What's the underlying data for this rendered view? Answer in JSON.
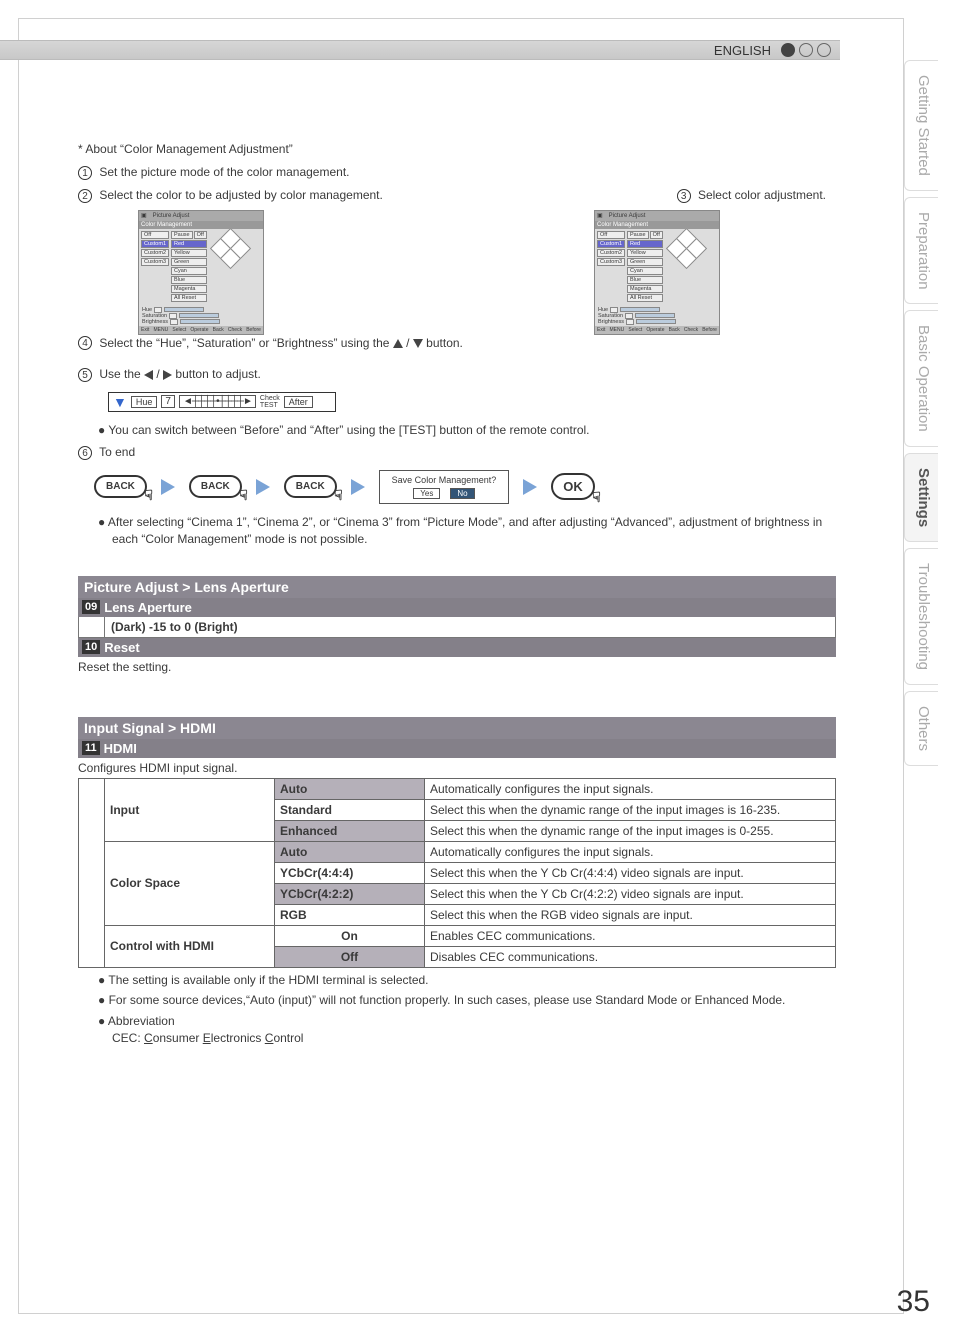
{
  "header": {
    "language": "ENGLISH"
  },
  "sidebar": {
    "tabs": [
      {
        "label": "Getting Started"
      },
      {
        "label": "Preparation"
      },
      {
        "label": "Basic Operation"
      },
      {
        "label": "Settings"
      },
      {
        "label": "Troubleshooting"
      },
      {
        "label": "Others"
      }
    ],
    "active_index": 3
  },
  "intro": {
    "about": "* About “Color Management Adjustment”",
    "step1": "Set the picture mode of the color management.",
    "step2": "Select the color to be adjusted by color management.",
    "step3": "Select color adjustment.",
    "step4_a": "Select the “Hue”, “Saturation” or “Brightness” using the ",
    "step4_b": " / ",
    "step4_c": " button.",
    "step5_a": "Use the ",
    "step5_b": " / ",
    "step5_c": " button to adjust.",
    "step6": "To end"
  },
  "onscreen": {
    "title": "Color Management",
    "modes": [
      "Off",
      "Custom1",
      "Custom2",
      "Custom3"
    ],
    "pause": "Pause",
    "off": "Off",
    "colors": [
      "Red",
      "Yellow",
      "Green",
      "Cyan",
      "Blue",
      "Magenta",
      "All Reset"
    ],
    "params": [
      "Hue",
      "Saturation",
      "Brightness"
    ],
    "footer": [
      "Exit",
      "MENU",
      "Select",
      "Operate",
      "Back",
      "Check",
      "Before"
    ],
    "footer2": [
      "Exit",
      "MENU",
      "Select",
      "Operate",
      "Back",
      "Check",
      "Before"
    ],
    "picture_adjust": "Picture Adjust"
  },
  "huebar": {
    "hue": "Hue",
    "num": "7",
    "check": "Check",
    "test": "TEST",
    "after": "After"
  },
  "note_switch": "You can switch between “Before” and “After” using the [TEST] button of the remote control.",
  "flow": {
    "back": "BACK",
    "ok": "OK",
    "save_q": "Save Color Management?",
    "yes": "Yes",
    "no": "No"
  },
  "note_cinema": "After selecting “Cinema 1”, “Cinema 2”, or “Cinema 3” from “Picture Mode”, and after adjusting “Advanced”, adjustment of brightness in each “Color Management” mode is not possible.",
  "lens": {
    "breadcrumb": "Picture Adjust  >  Lens Aperture",
    "num09": "09",
    "title09": "Lens Aperture",
    "range09": "(Dark) -15 to 0 (Bright)",
    "num10": "10",
    "title10": "Reset",
    "desc10": "Reset the setting."
  },
  "hdmi": {
    "breadcrumb": "Input Signal > HDMI",
    "num11": "11",
    "title11": "HDMI",
    "desc11": "Configures HDMI input signal.",
    "input_label": "Input",
    "colorspace_label": "Color Space",
    "control_label": "Control with HDMI",
    "rows": [
      {
        "opt": "Auto",
        "desc": "Automatically configures the input signals."
      },
      {
        "opt": "Standard",
        "desc": "Select this when the dynamic range of the input images is 16-235."
      },
      {
        "opt": "Enhanced",
        "desc": "Select this when the dynamic range of the input images is 0-255."
      },
      {
        "opt": "Auto",
        "desc": "Automatically configures the input signals."
      },
      {
        "opt": "YCbCr(4:4:4)",
        "desc": "Select this when the Y Cb Cr(4:4:4) video signals are input."
      },
      {
        "opt": "YCbCr(4:2:2)",
        "desc": "Select this when the Y Cb Cr(4:2:2) video signals are input."
      },
      {
        "opt": "RGB",
        "desc": "Select this when the RGB video signals are input."
      },
      {
        "opt": "On",
        "desc": "Enables CEC communications."
      },
      {
        "opt": "Off",
        "desc": "Disables CEC communications."
      }
    ]
  },
  "footnotes": {
    "n1": "The setting is available only if the HDMI terminal is selected.",
    "n2": "For some source devices,“Auto (input)” will not function properly. In such cases, please use Standard Mode or Enhanced Mode.",
    "n3": "Abbreviation",
    "n3b_pre": "CEC: ",
    "n3b_c": "C",
    "n3b_onsumer": "onsumer ",
    "n3b_e": "E",
    "n3b_lectronics": "lectronics ",
    "n3b_c2": "C",
    "n3b_ontrol": "ontrol"
  },
  "page_number": "35"
}
